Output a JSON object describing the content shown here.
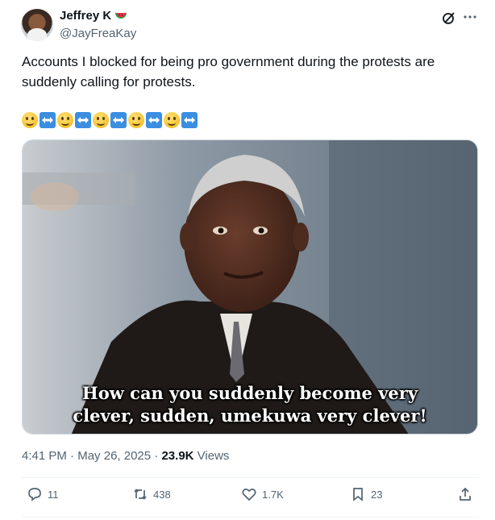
{
  "author": {
    "display_name": "Jeffrey K",
    "handle": "@JayFreaKay",
    "badge_icon": "watermelon-icon"
  },
  "tweet": {
    "text": "Accounts I blocked for being pro government during the protests are suddenly calling for protests.",
    "emoji_sequence": [
      "slightly-smiling-face",
      "left-right-arrow",
      "slightly-smiling-face",
      "left-right-arrow",
      "slightly-smiling-face",
      "left-right-arrow",
      "slightly-smiling-face",
      "left-right-arrow",
      "slightly-smiling-face",
      "left-right-arrow"
    ]
  },
  "media": {
    "caption_line1": "How can you suddenly become very",
    "caption_line2": "clever, sudden, umekuwa very clever!"
  },
  "meta": {
    "time": "4:41 PM",
    "separator": " · ",
    "date": "May 26, 2025",
    "views_count": "23.9K",
    "views_label": "Views"
  },
  "actions": {
    "replies": "11",
    "reposts": "438",
    "likes": "1.7K",
    "bookmarks": "23"
  },
  "colors": {
    "text_primary": "#0f1419",
    "text_secondary": "#536471",
    "divider": "#eff3f4",
    "emoji_arrow_bg": "#3b8ee0"
  }
}
